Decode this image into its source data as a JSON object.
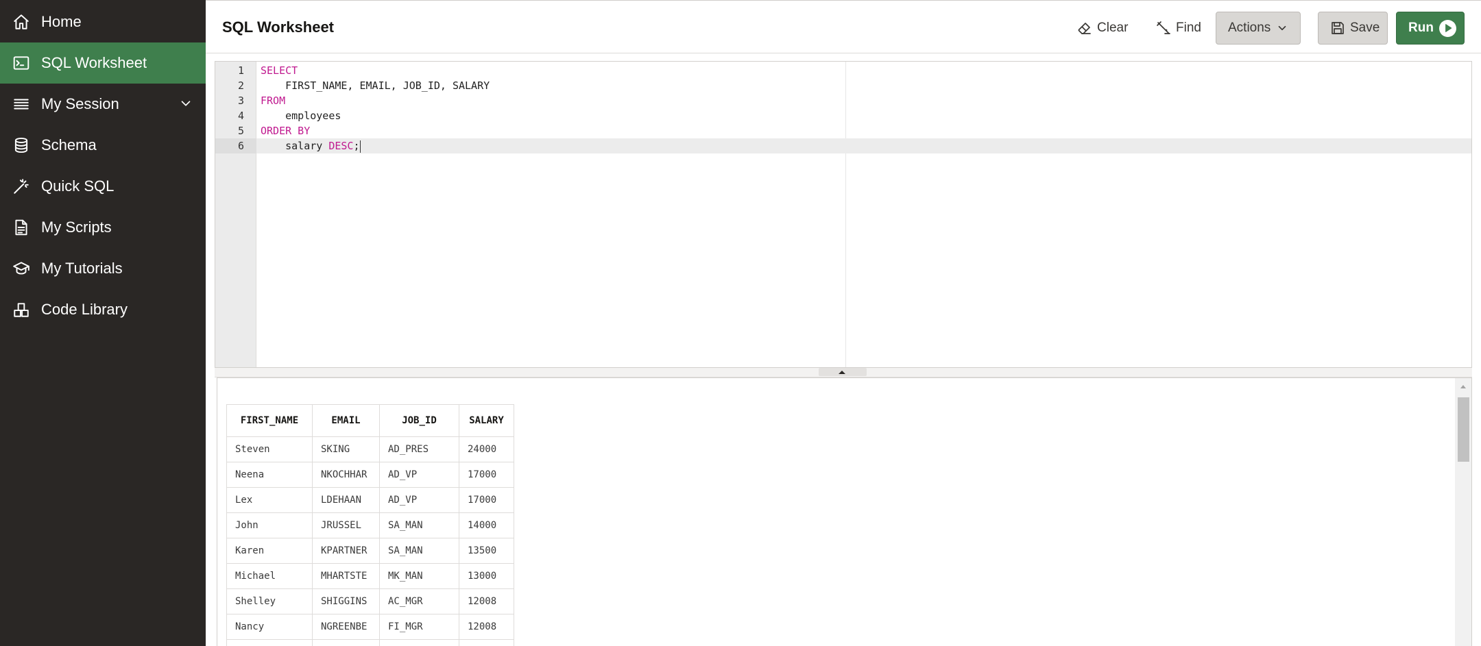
{
  "sidebar": {
    "items": [
      {
        "label": "Home",
        "icon": "home-icon"
      },
      {
        "label": "SQL Worksheet",
        "icon": "terminal-icon",
        "active": true
      },
      {
        "label": "My Session",
        "icon": "list-icon",
        "expandable": true
      },
      {
        "label": "Schema",
        "icon": "database-icon"
      },
      {
        "label": "Quick SQL",
        "icon": "magic-wand-icon"
      },
      {
        "label": "My Scripts",
        "icon": "document-icon"
      },
      {
        "label": "My Tutorials",
        "icon": "graduation-cap-icon"
      },
      {
        "label": "Code Library",
        "icon": "blocks-icon"
      }
    ]
  },
  "header": {
    "title": "SQL Worksheet",
    "clear_label": "Clear",
    "find_label": "Find",
    "actions_label": "Actions",
    "save_label": "Save",
    "run_label": "Run"
  },
  "editor": {
    "line_numbers": [
      "1",
      "2",
      "3",
      "4",
      "5",
      "6"
    ],
    "current_line": 6,
    "lines": [
      {
        "kw": "SELECT",
        "text": ""
      },
      {
        "kw": "",
        "text": "    FIRST_NAME, EMAIL, JOB_ID, SALARY"
      },
      {
        "kw": "FROM",
        "text": ""
      },
      {
        "kw": "",
        "text": "    employees"
      },
      {
        "kw": "ORDER BY",
        "text": ""
      },
      {
        "kw": "",
        "text": "    salary ",
        "kw2": "DESC",
        "tail": ";"
      }
    ]
  },
  "results": {
    "columns": [
      "FIRST_NAME",
      "EMAIL",
      "JOB_ID",
      "SALARY"
    ],
    "rows": [
      [
        "Steven",
        "SKING",
        "AD_PRES",
        "24000"
      ],
      [
        "Neena",
        "NKOCHHAR",
        "AD_VP",
        "17000"
      ],
      [
        "Lex",
        "LDEHAAN",
        "AD_VP",
        "17000"
      ],
      [
        "John",
        "JRUSSEL",
        "SA_MAN",
        "14000"
      ],
      [
        "Karen",
        "KPARTNER",
        "SA_MAN",
        "13500"
      ],
      [
        "Michael",
        "MHARTSTE",
        "MK_MAN",
        "13000"
      ],
      [
        "Shelley",
        "SHIGGINS",
        "AC_MGR",
        "12008"
      ],
      [
        "Nancy",
        "NGREENBE",
        "FI_MGR",
        "12008"
      ],
      [
        "",
        "",
        "",
        ""
      ]
    ]
  },
  "colors": {
    "sidebar_bg": "#2a2725",
    "active_green": "#3f7f4d",
    "keyword": "#c0198f"
  }
}
